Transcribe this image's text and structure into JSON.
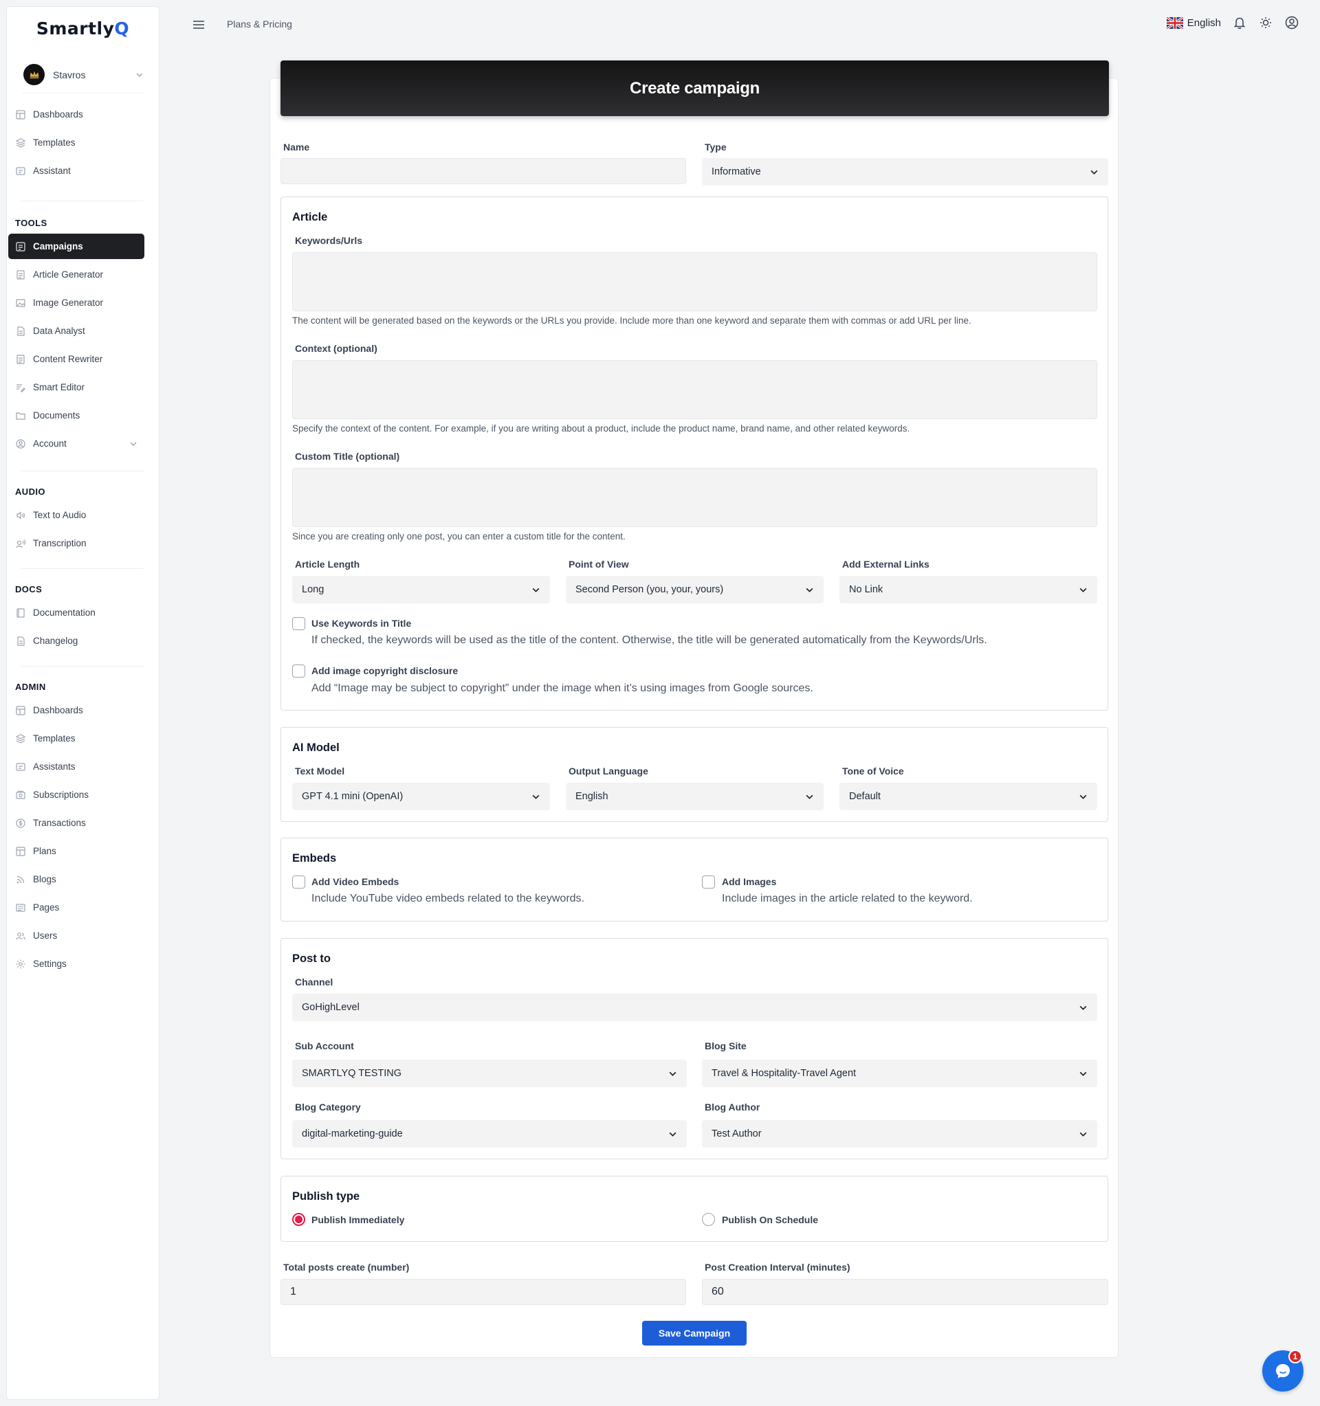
{
  "app": {
    "logo_main": "Smartly",
    "logo_accent": "Q",
    "breadcrumb": "Plans & Pricing",
    "language": "English"
  },
  "user": {
    "name": "Stavros"
  },
  "sidebar": {
    "main": [
      {
        "label": "Dashboards",
        "icon": "dashboard-icon"
      },
      {
        "label": "Templates",
        "icon": "layers-icon"
      },
      {
        "label": "Assistant",
        "icon": "chat-icon"
      }
    ],
    "tools_title": "TOOLS",
    "tools": [
      {
        "label": "Campaigns",
        "icon": "campaign-icon"
      },
      {
        "label": "Article Generator",
        "icon": "document-icon"
      },
      {
        "label": "Image Generator",
        "icon": "image-icon"
      },
      {
        "label": "Data Analyst",
        "icon": "file-icon"
      },
      {
        "label": "Content Rewriter",
        "icon": "document-icon"
      },
      {
        "label": "Smart Editor",
        "icon": "edit-icon"
      },
      {
        "label": "Documents",
        "icon": "folder-icon"
      },
      {
        "label": "Account",
        "icon": "user-circle-icon"
      }
    ],
    "audio_title": "AUDIO",
    "audio": [
      {
        "label": "Text to Audio",
        "icon": "speaker-icon"
      },
      {
        "label": "Transcription",
        "icon": "voice-icon"
      }
    ],
    "docs_title": "DOCS",
    "docs": [
      {
        "label": "Documentation",
        "icon": "book-icon"
      },
      {
        "label": "Changelog",
        "icon": "file-icon"
      }
    ],
    "admin_title": "ADMIN",
    "admin": [
      {
        "label": "Dashboards",
        "icon": "dashboard-icon"
      },
      {
        "label": "Templates",
        "icon": "layers-icon"
      },
      {
        "label": "Assistants",
        "icon": "chat-icon"
      },
      {
        "label": "Subscriptions",
        "icon": "subscription-icon"
      },
      {
        "label": "Transactions",
        "icon": "coin-icon"
      },
      {
        "label": "Plans",
        "icon": "dashboard-icon"
      },
      {
        "label": "Blogs",
        "icon": "rss-icon"
      },
      {
        "label": "Pages",
        "icon": "pages-icon"
      },
      {
        "label": "Users",
        "icon": "users-icon"
      },
      {
        "label": "Settings",
        "icon": "gear-icon"
      }
    ]
  },
  "form": {
    "title": "Create campaign",
    "name_label": "Name",
    "name_value": "",
    "type_label": "Type",
    "type_value": "Informative",
    "article": {
      "title": "Article",
      "keywords_label": "Keywords/Urls",
      "keywords_help": "The content will be generated based on the keywords or the URLs you provide. Include more than one keyword and separate them with commas or add URL per line.",
      "context_label": "Context (optional)",
      "context_help": "Specify the context of the content. For example, if you are writing about a product, include the product name, brand name, and other related keywords.",
      "custom_title_label": "Custom Title (optional)",
      "custom_title_help": "Since you are creating only one post, you can enter a custom title for the content.",
      "length_label": "Article Length",
      "length_value": "Long",
      "pov_label": "Point of View",
      "pov_value": "Second Person (you, your, yours)",
      "links_label": "Add External Links",
      "links_value": "No Link",
      "kw_title_label": "Use Keywords in Title",
      "kw_title_desc": "If checked, the keywords will be used as the title of the content. Otherwise, the title will be generated automatically from the Keywords/Urls.",
      "copyright_label": "Add image copyright disclosure",
      "copyright_desc": "Add “Image may be subject to copyright” under the image when it’s using images from Google sources."
    },
    "ai_model": {
      "title": "AI Model",
      "text_model_label": "Text Model",
      "text_model_value": "GPT 4.1 mini (OpenAI)",
      "output_language_label": "Output Language",
      "output_language_value": "English",
      "tone_label": "Tone of Voice",
      "tone_value": "Default"
    },
    "embeds": {
      "title": "Embeds",
      "video_label": "Add Video Embeds",
      "video_desc": "Include YouTube video embeds related to the keywords.",
      "images_label": "Add Images",
      "images_desc": "Include images in the article related to the keyword."
    },
    "post_to": {
      "title": "Post to",
      "channel_label": "Channel",
      "channel_value": "GoHighLevel",
      "sub_account_label": "Sub Account",
      "sub_account_value": "SMARTLYQ TESTING",
      "blog_site_label": "Blog Site",
      "blog_site_value": "Travel & Hospitality-Travel Agent",
      "blog_category_label": "Blog Category",
      "blog_category_value": "digital-marketing-guide",
      "blog_author_label": "Blog Author",
      "blog_author_value": "Test Author"
    },
    "publish": {
      "title": "Publish type",
      "immediately_label": "Publish Immediately",
      "schedule_label": "Publish On Schedule",
      "selected": "immediately"
    },
    "total_posts_label": "Total posts create (number)",
    "total_posts_value": "1",
    "interval_label": "Post Creation Interval (minutes)",
    "interval_value": "60",
    "save_label": "Save Campaign"
  },
  "chat": {
    "badge": "1"
  }
}
